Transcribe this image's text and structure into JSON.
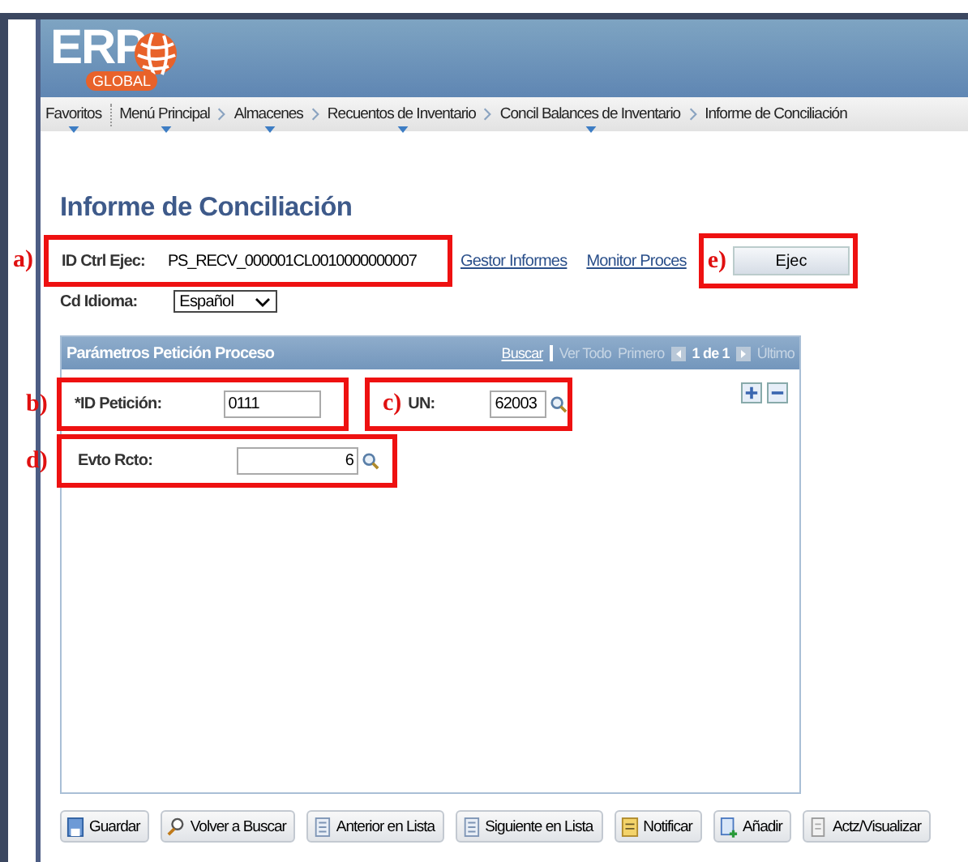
{
  "header": {
    "logo_text": "ERP",
    "logo_subtext": "GLOBAL"
  },
  "breadcrumbs": [
    {
      "label": "Favoritos",
      "has_menu": true
    },
    {
      "label": "Menú Principal",
      "has_menu": true
    },
    {
      "label": "Almacenes",
      "has_menu": true
    },
    {
      "label": "Recuentos de Inventario",
      "has_menu": true
    },
    {
      "label": "Concil Balances de Inventario",
      "has_menu": true
    },
    {
      "label": "Informe de Conciliación",
      "has_menu": false
    }
  ],
  "page_title": "Informe de Conciliación",
  "run_control": {
    "marker": "a)",
    "label": "ID Ctrl Ejec:",
    "value": "PS_RECV_000001CL0010000000007"
  },
  "links": [
    "Gestor Informes",
    "Monitor Proces"
  ],
  "run_button": {
    "marker": "e)",
    "label": "Ejec"
  },
  "language": {
    "label": "Cd Idioma:",
    "value": "Español"
  },
  "panel": {
    "title": "Parámetros Petición Proceso",
    "search": "Buscar",
    "view_all": "Ver Todo",
    "first": "Primero",
    "position": "1 de 1",
    "last": "Último",
    "fields": [
      {
        "marker": "b)",
        "label": "*ID Petición:",
        "value": "0111",
        "lookup": false
      },
      {
        "marker": "c)",
        "label": "UN:",
        "value": "62003",
        "lookup": true
      },
      {
        "marker": "d)",
        "label": "Evto Rcto:",
        "value": "6",
        "lookup": true
      }
    ]
  },
  "toolbar": [
    {
      "label": "Guardar"
    },
    {
      "label": "Volver a Buscar"
    },
    {
      "label": "Anterior en Lista"
    },
    {
      "label": "Siguiente en Lista"
    },
    {
      "label": "Notificar"
    },
    {
      "label": "Añadir"
    },
    {
      "label": "Actz/Visualizar"
    }
  ]
}
